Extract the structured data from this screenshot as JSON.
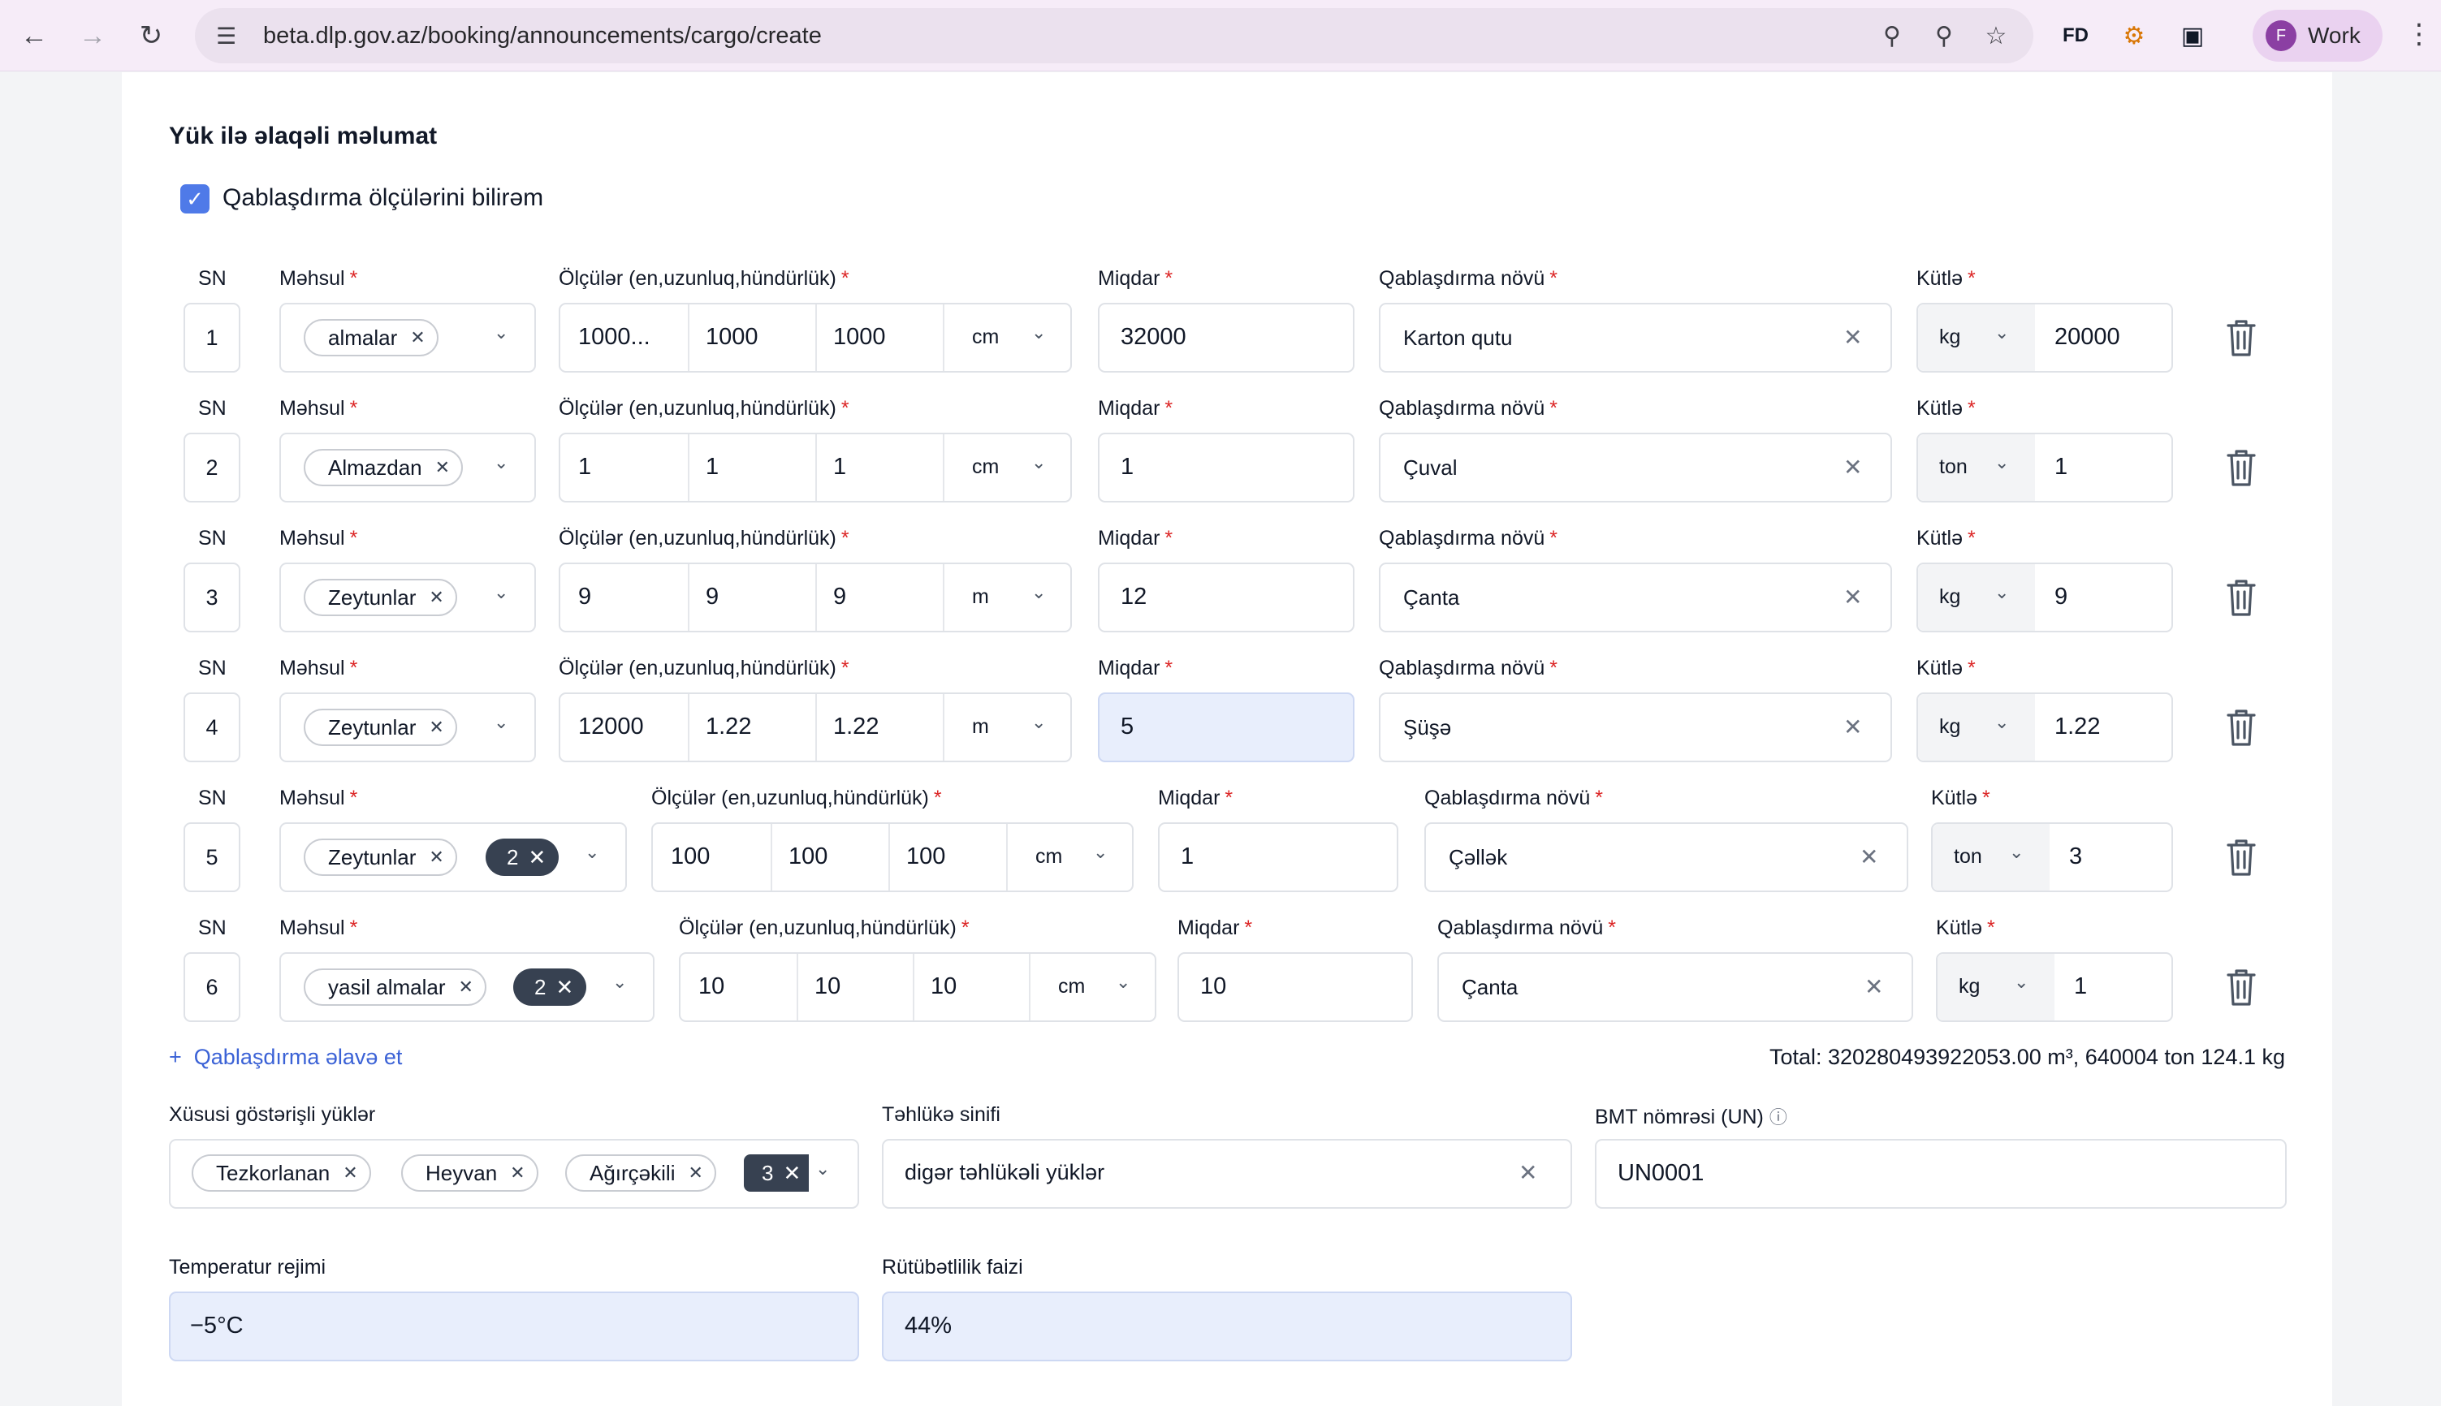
{
  "browser": {
    "url": "beta.dlp.gov.az/booking/announcements/cargo/create",
    "profile_initial": "F",
    "profile_label": "Work"
  },
  "section": {
    "title": "Yük ilə əlaqəli məlumat",
    "checkbox_label": "Qablaşdırma ölçülərini bilirəm",
    "checkbox_checked": true
  },
  "labels": {
    "sn": "SN",
    "product": "Məhsul",
    "dimensions": "Ölçülər (en,uzunluq,hündürlük)",
    "quantity": "Miqdar",
    "packaging": "Qablaşdırma növü",
    "weight": "Kütlə",
    "required": "*"
  },
  "rows": [
    {
      "sn": "1",
      "product": "almalar",
      "extra_count": "",
      "d1": "1000...",
      "d2": "1000",
      "d3": "1000",
      "unit": "cm",
      "quantity": "32000",
      "packaging": "Karton qutu",
      "weight_unit": "kg",
      "weight": "20000"
    },
    {
      "sn": "2",
      "product": "Almazdan",
      "extra_count": "",
      "d1": "1",
      "d2": "1",
      "d3": "1",
      "unit": "cm",
      "quantity": "1",
      "packaging": "Çuval",
      "weight_unit": "ton",
      "weight": "1"
    },
    {
      "sn": "3",
      "product": "Zeytunlar",
      "extra_count": "",
      "d1": "9",
      "d2": "9",
      "d3": "9",
      "unit": "m",
      "quantity": "12",
      "packaging": "Çanta",
      "weight_unit": "kg",
      "weight": "9"
    },
    {
      "sn": "4",
      "product": "Zeytunlar",
      "extra_count": "",
      "d1": "12000",
      "d2": "1.22",
      "d3": "1.22",
      "unit": "m",
      "quantity": "5",
      "packaging": "Şüşə",
      "weight_unit": "kg",
      "weight": "1.22"
    },
    {
      "sn": "5",
      "product": "Zeytunlar",
      "extra_count": "2",
      "d1": "100",
      "d2": "100",
      "d3": "100",
      "unit": "cm",
      "quantity": "1",
      "packaging": "Çəllək",
      "weight_unit": "ton",
      "weight": "3"
    },
    {
      "sn": "6",
      "product": "yasil almalar",
      "extra_count": "2",
      "d1": "10",
      "d2": "10",
      "d3": "10",
      "unit": "cm",
      "quantity": "10",
      "packaging": "Çanta",
      "weight_unit": "kg",
      "weight": "1"
    }
  ],
  "add_packaging": "Qablaşdırma əlavə et",
  "total": "Total: 320280493922053.00 m³, 640004 ton 124.1 kg",
  "special": {
    "label": "Xüsusi göstərişli yüklər",
    "tags": [
      "Tezkorlanan",
      "Heyvan",
      "Ağırçəkili"
    ],
    "more_count": "3"
  },
  "danger": {
    "label": "Təhlükə sinifi",
    "value": "digər təhlükəli yüklər"
  },
  "un": {
    "label": "BMT nömrəsi (UN)",
    "value": "UN0001"
  },
  "temperature": {
    "label": "Temperatur rejimi",
    "value": "−5°C"
  },
  "humidity": {
    "label": "Rütübətlilik faizi",
    "value": "44%"
  },
  "colors": {
    "accent": "#4f7ae8",
    "required": "#dc2626",
    "highlight": "#e8eefc"
  }
}
